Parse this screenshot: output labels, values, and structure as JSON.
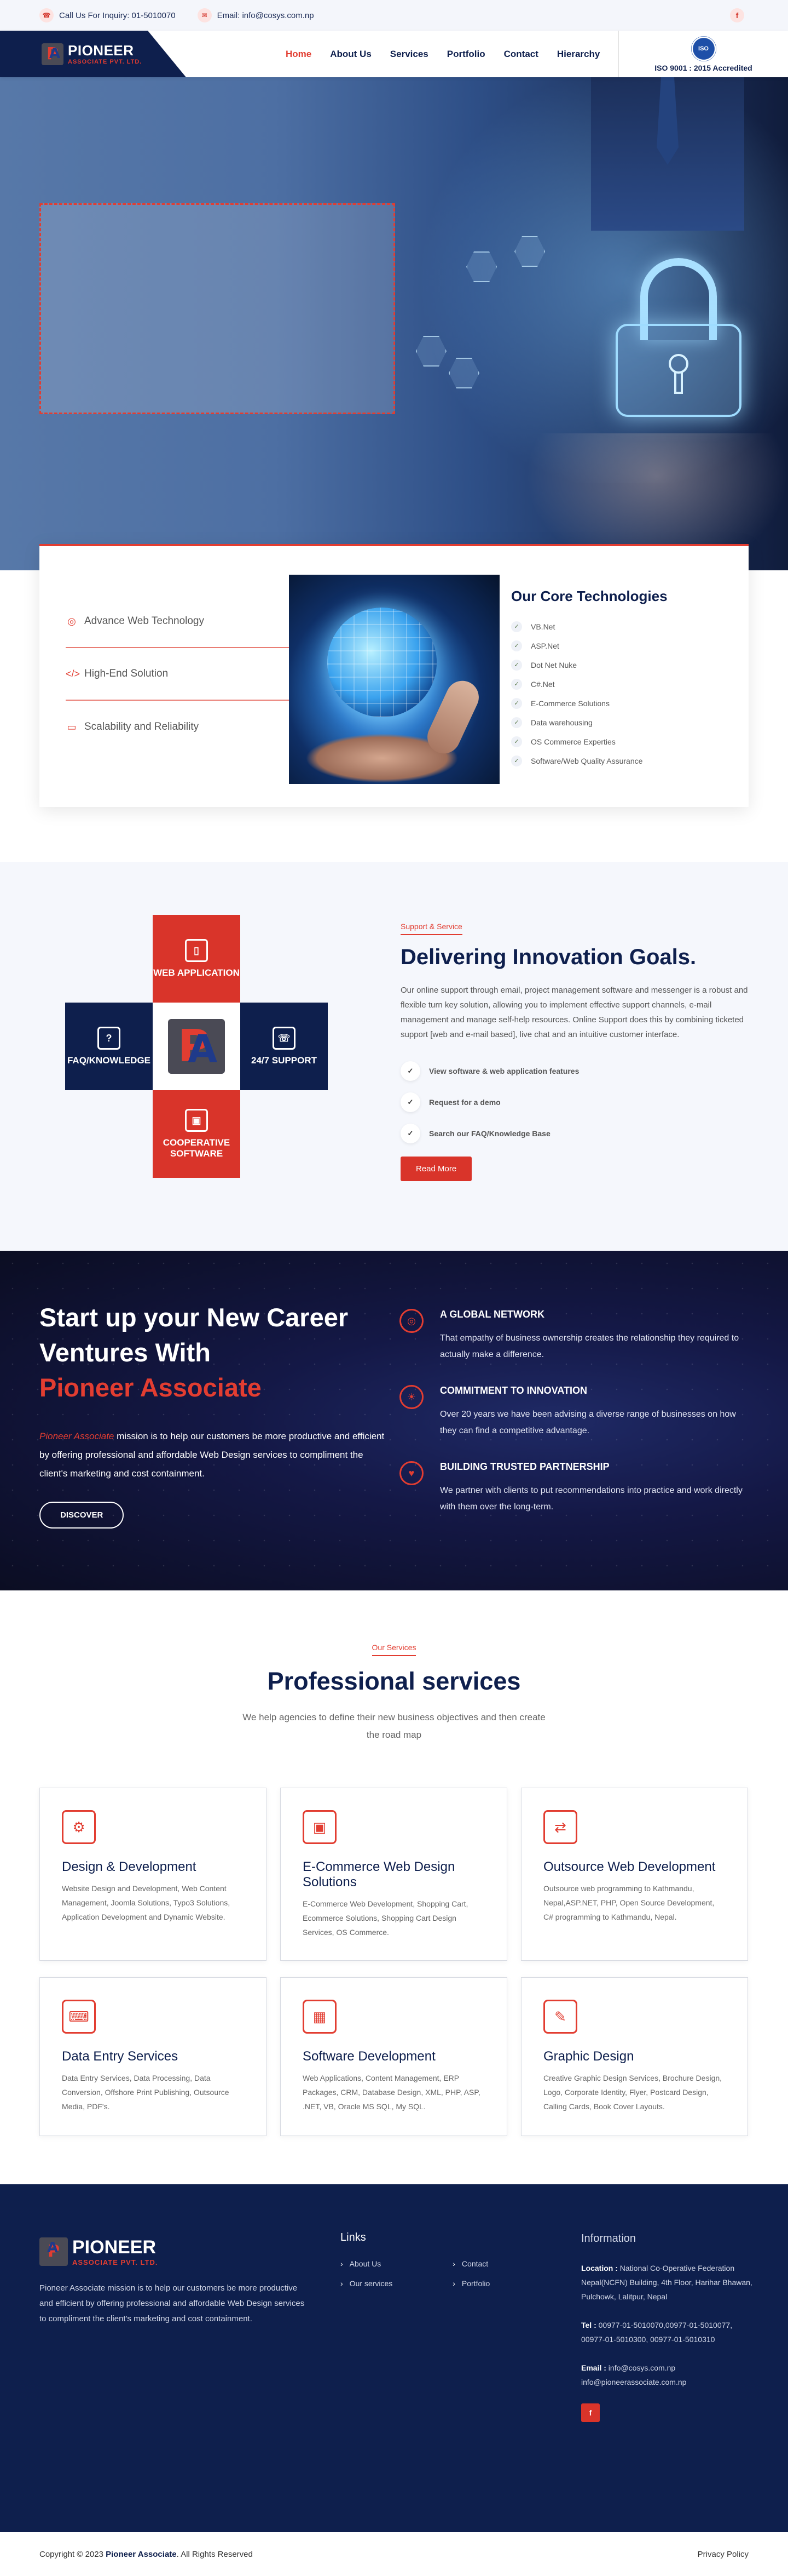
{
  "topbar": {
    "phone_icon": "phone-icon",
    "phone": "Call Us For Inquiry: 01-5010070",
    "email_icon": "mail-icon",
    "email": "Email: info@cosys.com.np",
    "fb_glyph": "f"
  },
  "header": {
    "logo_name": "PIONEER",
    "logo_sub": "ASSOCIATE PVT. LTD.",
    "nav": [
      "Home",
      "About Us",
      "Services",
      "Portfolio",
      "Contact",
      "Hierarchy"
    ],
    "active_nav": "Home",
    "iso_text": "ISO 9001 : 2015 Accredited",
    "iso_seal": "ISO"
  },
  "core": {
    "features": [
      {
        "icon": "globe-icon",
        "glyph": "◎",
        "label": "Advance Web Technology"
      },
      {
        "icon": "code-icon",
        "glyph": "</>",
        "label": "High-End Solution"
      },
      {
        "icon": "server-icon",
        "glyph": "▭",
        "label": "Scalability and Reliability"
      }
    ],
    "title": "Our Core Technologies",
    "items": [
      "VB.Net",
      "ASP.Net",
      "Dot Net Nuke",
      "C#.Net",
      "E-Commerce Solutions",
      "Data warehousing",
      "OS Commerce Experties",
      "Software/Web Quality Assurance"
    ]
  },
  "support": {
    "tiles": {
      "web": "WEB APPLICATION",
      "faq": "FAQ/KNOWLEDGE",
      "support": "24/7 SUPPORT",
      "coop": "COOPERATIVE SOFTWARE"
    },
    "tag": "Support & Service",
    "title": "Delivering Innovation Goals.",
    "paragraph": "Our online support through email, project management software and messenger is a robust and flexible turn key solution, allowing you to implement effective support channels, e-mail management and manage self-help resources. Online Support does this by combining ticketed support [web and e-mail based], live chat and an intuitive customer interface.",
    "list": [
      "View software & web application features",
      "Request for a demo",
      "Search our FAQ/Knowledge Base"
    ],
    "button": "Read More"
  },
  "career": {
    "line1": "Start up your New Career",
    "line2": "Ventures With",
    "line3": "Pioneer Associate",
    "brand": "Pioneer Associate",
    "text": " mission is to help our customers be more productive and efficient by offering professional and affordable Web Design services to compliment the client's marketing and cost containment.",
    "button": "DISCOVER",
    "points": [
      {
        "icon": "globe-icon",
        "glyph": "◎",
        "title": "A GLOBAL NETWORK",
        "text": "That empathy of business ownership creates the relationship they required to actually make a difference."
      },
      {
        "icon": "lightbulb-icon",
        "glyph": "☀",
        "title": "COMMITMENT TO INNOVATION",
        "text": "Over 20 years we have been advising a diverse range of businesses on how they can find a competitive advantage."
      },
      {
        "icon": "handshake-icon",
        "glyph": "♥",
        "title": "BUILDING TRUSTED PARTNERSHIP",
        "text": "We partner with clients to put recommendations into practice and work directly with them over the long-term."
      }
    ]
  },
  "services": {
    "tag": "Our Services",
    "title": "Professional services",
    "lead": "We help agencies to define their new business objectives and then create the road map",
    "cards": [
      {
        "icon": "design-gear-icon",
        "glyph": "⚙",
        "title": "Design & Development",
        "text": "Website Design and Development, Web Content Management, Joomla Solutions, Typo3 Solutions, Application Development and Dynamic Website."
      },
      {
        "icon": "ecommerce-icon",
        "glyph": "▣",
        "title": "E-Commerce Web Design Solutions",
        "text": "E-Commerce Web Development, Shopping Cart, Ecommerce Solutions, Shopping Cart Design Services, OS Commerce."
      },
      {
        "icon": "outsource-icon",
        "glyph": "⇄",
        "title": "Outsource Web Development",
        "text": "Outsource web programming to Kathmandu, Nepal,ASP.NET, PHP, Open Source Development, C# programming to Kathmandu, Nepal."
      },
      {
        "icon": "data-entry-icon",
        "glyph": "⌨",
        "title": "Data Entry Services",
        "text": "Data Entry Services, Data Processing, Data Conversion, Offshore Print Publishing, Outsource Media, PDF's."
      },
      {
        "icon": "software-icon",
        "glyph": "▦",
        "title": "Software Development",
        "text": "Web Applications, Content Management, ERP Packages, CRM, Database Design, XML, PHP, ASP, .NET, VB, Oracle MS SQL, My SQL."
      },
      {
        "icon": "graphic-design-icon",
        "glyph": "✎",
        "title": "Graphic Design",
        "text": "Creative Graphic Design Services, Brochure Design, Logo, Corporate Identity, Flyer, Postcard Design, Calling Cards, Book Cover Layouts."
      }
    ]
  },
  "footer": {
    "logo_name": "PIONEER",
    "logo_sub": "ASSOCIATE PVT. LTD.",
    "about": "Pioneer Associate mission is to help our customers be more productive and efficient by offering professional and affordable Web Design services to compliment the client's marketing and cost containment.",
    "links_title": "Links",
    "links_col1": [
      "About Us",
      "Our services"
    ],
    "links_col2": [
      "Contact",
      "Portfolio"
    ],
    "info_title": "Information",
    "location_label": "Location :",
    "location": " National Co-Operative Federation Nepal(NCFN) Building, 4th Floor, Harihar Bhawan, Pulchowk, Lalitpur, Nepal",
    "tel_label": "Tel :",
    "tel": " 00977-01-5010070,00977-01-5010077, 00977-01-5010300, 00977-01-5010310",
    "email_label": "Email :",
    "email": " info@cosys.com.np info@pioneerassociate.com.np",
    "fb_glyph": "f"
  },
  "copyright": {
    "prefix": "Copyright © 2023 ",
    "brand": "Pioneer Associate",
    "suffix": ". All Rights Reserved",
    "privacy": "Privacy Policy"
  },
  "colors": {
    "accent": "#d9342a",
    "navy": "#0e1f4d"
  }
}
